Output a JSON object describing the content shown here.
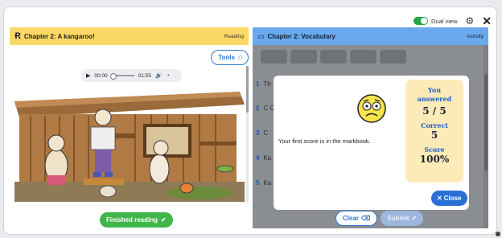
{
  "topbar": {
    "dual_view_label": "Dual view",
    "settings_icon": "gear-icon",
    "close_icon": "close-icon",
    "toggle_color": "#22a640"
  },
  "reading": {
    "title": "Chapter 2: A kangaroo!",
    "tag": "Reading",
    "header_color": "#fcd966",
    "tools_label": "Tools",
    "audio": {
      "current_time": "00:00",
      "duration": "01:55",
      "progress": 0
    },
    "finished_label": "Finished reading"
  },
  "activity": {
    "title": "Chapter 2: Vocabulary",
    "tag": "Activity",
    "header_color": "#6aa9ec",
    "questions": [
      {
        "number": "1",
        "text": "Th"
      },
      {
        "number": "2",
        "text": "C C"
      },
      {
        "number": "3",
        "text": "C"
      },
      {
        "number": "4",
        "text": "Ka"
      },
      {
        "number": "5",
        "text": "Ka"
      }
    ],
    "clear_label": "Clear",
    "submit_label": "Submit"
  },
  "modal": {
    "message": "Your first score is in the markbook.",
    "answered_label": "You answered",
    "answered_value": "5 / 5",
    "correct_label": "Correct",
    "correct_value": "5",
    "score_label": "Score",
    "score_value": "100%",
    "close_label": "Close"
  }
}
